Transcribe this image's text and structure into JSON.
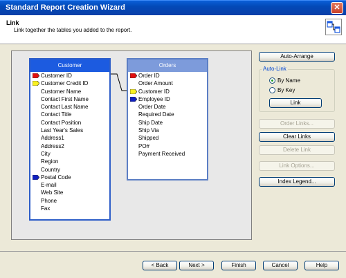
{
  "window": {
    "title": "Standard Report Creation Wizard",
    "close_glyph": "✕"
  },
  "header": {
    "title": "Link",
    "subtitle": "Link together the tables you added to the report.",
    "icon": "link-tables-icon"
  },
  "tables": {
    "customer": {
      "name": "Customer",
      "fields": [
        {
          "label": "Customer ID",
          "flag": "red"
        },
        {
          "label": "Customer Credit ID",
          "flag": "yellow"
        },
        {
          "label": "Customer Name",
          "flag": ""
        },
        {
          "label": "Contact First Name",
          "flag": ""
        },
        {
          "label": "Contact Last Name",
          "flag": ""
        },
        {
          "label": "Contact Title",
          "flag": ""
        },
        {
          "label": "Contact Position",
          "flag": ""
        },
        {
          "label": "Last Year's Sales",
          "flag": ""
        },
        {
          "label": "Address1",
          "flag": ""
        },
        {
          "label": "Address2",
          "flag": ""
        },
        {
          "label": "City",
          "flag": ""
        },
        {
          "label": "Region",
          "flag": ""
        },
        {
          "label": "Country",
          "flag": ""
        },
        {
          "label": "Postal Code",
          "flag": "blue"
        },
        {
          "label": "E-mail",
          "flag": ""
        },
        {
          "label": "Web Site",
          "flag": ""
        },
        {
          "label": "Phone",
          "flag": ""
        },
        {
          "label": "Fax",
          "flag": ""
        }
      ]
    },
    "orders": {
      "name": "Orders",
      "fields": [
        {
          "label": "Order ID",
          "flag": "red"
        },
        {
          "label": "Order Amount",
          "flag": ""
        },
        {
          "label": "Customer ID",
          "flag": "yellow"
        },
        {
          "label": "Employee ID",
          "flag": "blue"
        },
        {
          "label": "Order Date",
          "flag": ""
        },
        {
          "label": "Required Date",
          "flag": ""
        },
        {
          "label": "Ship Date",
          "flag": ""
        },
        {
          "label": "Ship Via",
          "flag": ""
        },
        {
          "label": "Shipped",
          "flag": ""
        },
        {
          "label": "PO#",
          "flag": ""
        },
        {
          "label": "Payment Received",
          "flag": ""
        }
      ]
    }
  },
  "flag_colors": {
    "red": "#E01010",
    "yellow": "#F8F020",
    "blue": "#1020C0"
  },
  "side": {
    "auto_arrange": "Auto-Arrange",
    "auto_link": {
      "title": "Auto-Link",
      "by_name": "By Name",
      "by_key": "By Key",
      "selected": "By Name",
      "link": "Link"
    },
    "order_links": "Order Links...",
    "clear_links": "Clear Links",
    "delete_link": "Delete Link",
    "link_options": "Link Options...",
    "index_legend": "Index Legend..."
  },
  "footer": {
    "back": "< Back",
    "next": "Next >",
    "finish": "Finish",
    "cancel": "Cancel",
    "help": "Help"
  }
}
